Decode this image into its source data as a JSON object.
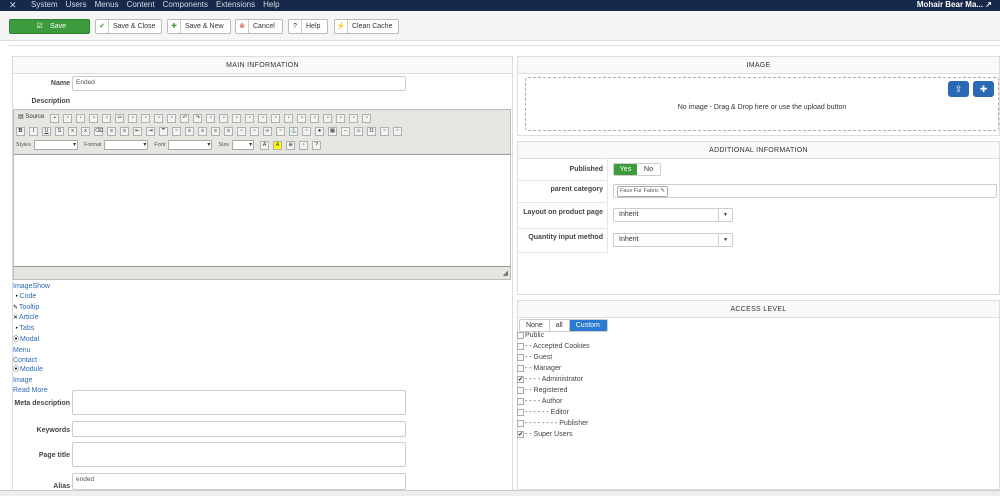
{
  "topbar": {
    "menu": [
      "System",
      "Users",
      "Menus",
      "Content",
      "Components",
      "Extensions",
      "Help"
    ],
    "site_name": "Mohair Bear Ma... ↗"
  },
  "toolbar": {
    "save": "Save",
    "save_close": "Save & Close",
    "save_new": "Save & New",
    "cancel": "Cancel",
    "help": "Help",
    "clean_cache": "Clean Cache"
  },
  "main_info": {
    "title": "MAIN INFORMATION",
    "name_label": "Name",
    "name_value": "Ended",
    "description_label": "Description",
    "editor": {
      "source": "Source",
      "styles": "Styles",
      "format": "Format",
      "font": "Font",
      "size": "Size"
    },
    "links": [
      "ImageShow",
      "Code",
      "Tooltip",
      "Article",
      "Tabs",
      "Modal",
      "Menu",
      "Contact",
      "Module",
      "Image",
      "Read More"
    ],
    "meta_description_label": "Meta description",
    "keywords_label": "Keywords",
    "page_title_label": "Page title",
    "alias_label": "Alias",
    "alias_value": "ended"
  },
  "image": {
    "title": "IMAGE",
    "drop_text": "No image - Drag & Drop here or use the upload button"
  },
  "additional": {
    "title": "ADDITIONAL INFORMATION",
    "published_label": "Published",
    "yes": "Yes",
    "no": "No",
    "parent_label": "parent category",
    "parent_value": "Faux Fur Fabric",
    "layout_label": "Layout on product page",
    "layout_value": "Inherit",
    "qty_label": "Quantity input method",
    "qty_value": "Inherit"
  },
  "access": {
    "title": "ACCESS LEVEL",
    "tabs": [
      "None",
      "all",
      "Custom"
    ],
    "items": [
      {
        "label": "Public",
        "checked": false
      },
      {
        "label": "- - Accepted Cookies",
        "checked": false
      },
      {
        "label": "- - Guest",
        "checked": false
      },
      {
        "label": "- - Manager",
        "checked": false
      },
      {
        "label": "- - - - Administrator",
        "checked": true
      },
      {
        "label": "- - Registered",
        "checked": false
      },
      {
        "label": "- - - - Author",
        "checked": false
      },
      {
        "label": "- - - - - - Editor",
        "checked": false
      },
      {
        "label": "- - - - - - - - Publisher",
        "checked": false
      },
      {
        "label": "- - Super Users",
        "checked": true
      }
    ]
  },
  "colors": {
    "topbar": "#17294a",
    "save": "#3c9b3c",
    "accent": "#2a7ad1"
  }
}
